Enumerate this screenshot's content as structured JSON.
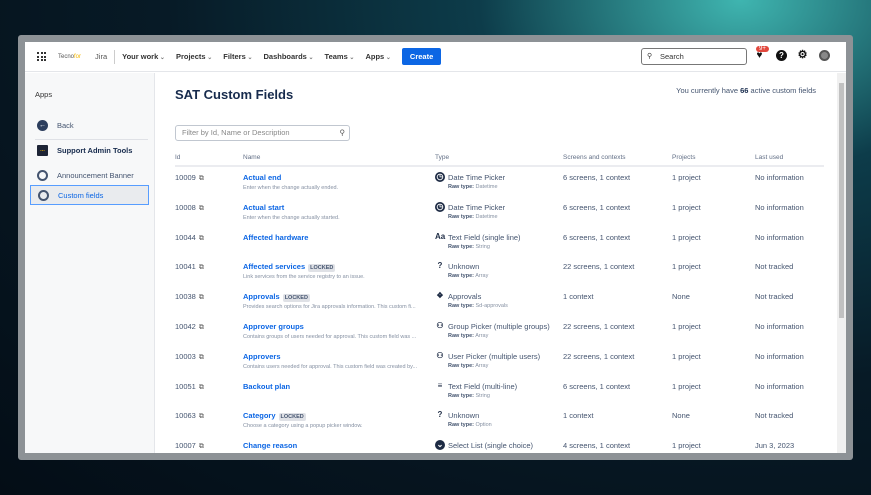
{
  "header": {
    "logo": "Tecno",
    "logo_accent": "for",
    "product": "Jira",
    "nav": [
      "Your work",
      "Projects",
      "Filters",
      "Dashboards",
      "Teams",
      "Apps"
    ],
    "create": "Create",
    "search_placeholder": "Search",
    "notifications": "9+"
  },
  "sidebar": {
    "heading": "Apps",
    "items": [
      {
        "label": "Back",
        "icon": "back-arrow-icon"
      },
      {
        "label": "Support Admin Tools",
        "icon": "app-logo-icon"
      },
      {
        "label": "Announcement Banner",
        "icon": "gear-icon"
      },
      {
        "label": "Custom fields",
        "icon": "gear-icon",
        "active": true
      }
    ]
  },
  "main": {
    "title": "SAT Custom Fields",
    "count_prefix": "You currently have",
    "count": "66",
    "count_suffix": "active custom fields",
    "filter_placeholder": "Filter by Id, Name or Description",
    "columns": [
      "Id",
      "Name",
      "Type",
      "Screens and contexts",
      "Projects",
      "Last used"
    ],
    "raw_label": "Raw type:",
    "locked_label": "LOCKED",
    "rows": [
      {
        "id": "10009",
        "name": "Actual end",
        "desc": "Enter when the change actually ended.",
        "type": "Date Time Picker",
        "raw": "Datetime",
        "icon": "clock",
        "screens": "6 screens, 1 context",
        "projects": "1 project",
        "last": "No information"
      },
      {
        "id": "10008",
        "name": "Actual start",
        "desc": "Enter when the change actually started.",
        "type": "Date Time Picker",
        "raw": "Datetime",
        "icon": "clock",
        "screens": "6 screens, 1 context",
        "projects": "1 project",
        "last": "No information"
      },
      {
        "id": "10044",
        "name": "Affected hardware",
        "desc": "",
        "type": "Text Field (single line)",
        "raw": "String",
        "icon": "text",
        "screens": "6 screens, 1 context",
        "projects": "1 project",
        "last": "No information"
      },
      {
        "id": "10041",
        "name": "Affected services",
        "locked": true,
        "desc": "Link services from the service registry to an issue.",
        "type": "Unknown",
        "raw": "Array",
        "icon": "question",
        "screens": "22 screens, 1 context",
        "projects": "1 project",
        "last": "Not tracked"
      },
      {
        "id": "10038",
        "name": "Approvals",
        "locked": true,
        "desc": "Provides search options for Jira approvals information. This custom fi...",
        "type": "Approvals",
        "raw": "Sd-approvals",
        "icon": "approvals",
        "screens": "1 context",
        "projects": "None",
        "last": "Not tracked"
      },
      {
        "id": "10042",
        "name": "Approver groups",
        "desc": "Contains groups of users needed for approval. This custom field was ...",
        "type": "Group Picker (multiple groups)",
        "raw": "Array",
        "icon": "group",
        "screens": "22 screens, 1 context",
        "projects": "1 project",
        "last": "No information"
      },
      {
        "id": "10003",
        "name": "Approvers",
        "desc": "Contains users needed for approval. This custom field was created by...",
        "type": "User Picker (multiple users)",
        "raw": "Array",
        "icon": "users",
        "screens": "22 screens, 1 context",
        "projects": "1 project",
        "last": "No information"
      },
      {
        "id": "10051",
        "name": "Backout plan",
        "desc": "",
        "type": "Text Field (multi-line)",
        "raw": "String",
        "icon": "lines",
        "screens": "6 screens, 1 context",
        "projects": "1 project",
        "last": "No information"
      },
      {
        "id": "10063",
        "name": "Category",
        "locked": true,
        "desc": "Choose a category using a popup picker window.",
        "type": "Unknown",
        "raw": "Option",
        "icon": "question",
        "screens": "1 context",
        "projects": "None",
        "last": "Not tracked"
      },
      {
        "id": "10007",
        "name": "Change reason",
        "desc": "",
        "type": "Select List (single choice)",
        "raw": "",
        "icon": "select",
        "screens": "4 screens, 1 context",
        "projects": "1 project",
        "last": "Jun 3, 2023"
      }
    ]
  }
}
